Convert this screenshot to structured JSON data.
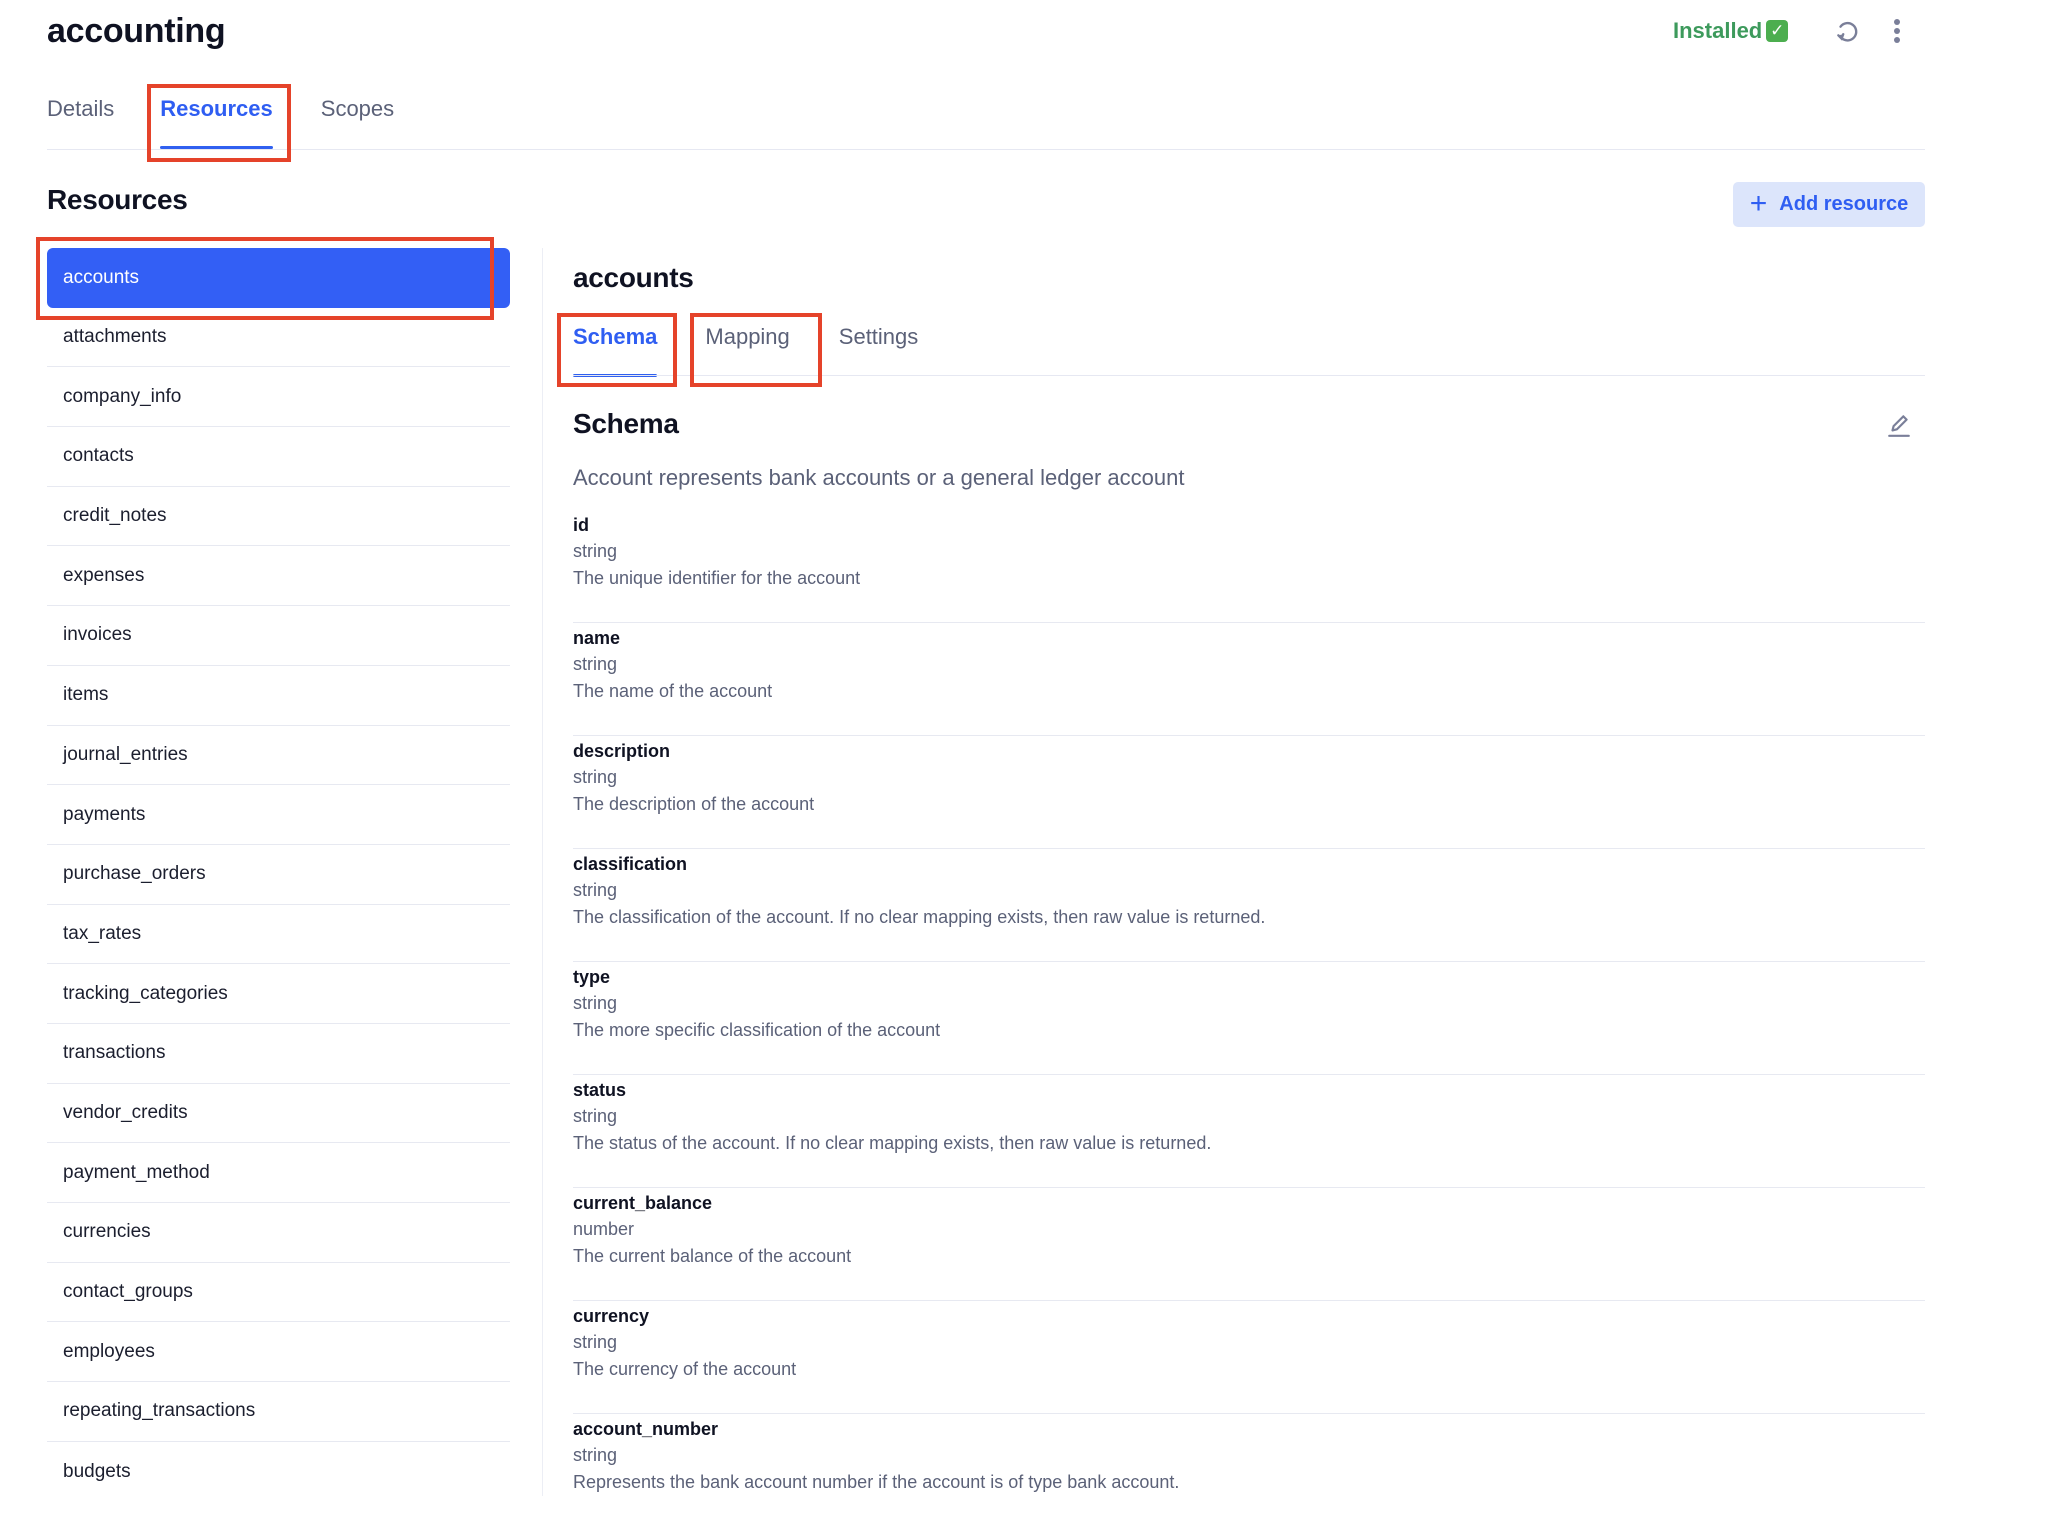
{
  "header": {
    "title": "accounting",
    "status_label": "Installed",
    "status_icon": "check-mark-button-icon",
    "status_color": "#3d9a5c",
    "actions": [
      "refresh-icon",
      "more-vertical-icon"
    ]
  },
  "top_tabs": [
    {
      "label": "Details",
      "active": false
    },
    {
      "label": "Resources",
      "active": true
    },
    {
      "label": "Scopes",
      "active": false
    }
  ],
  "resources": {
    "heading": "Resources",
    "add_button_label": "Add resource",
    "items": [
      {
        "label": "accounts",
        "active": true
      },
      {
        "label": "attachments"
      },
      {
        "label": "company_info"
      },
      {
        "label": "contacts"
      },
      {
        "label": "credit_notes"
      },
      {
        "label": "expenses"
      },
      {
        "label": "invoices"
      },
      {
        "label": "items"
      },
      {
        "label": "journal_entries"
      },
      {
        "label": "payments"
      },
      {
        "label": "purchase_orders"
      },
      {
        "label": "tax_rates"
      },
      {
        "label": "tracking_categories"
      },
      {
        "label": "transactions"
      },
      {
        "label": "vendor_credits"
      },
      {
        "label": "payment_method"
      },
      {
        "label": "currencies"
      },
      {
        "label": "contact_groups"
      },
      {
        "label": "employees"
      },
      {
        "label": "repeating_transactions"
      },
      {
        "label": "budgets"
      }
    ]
  },
  "detail": {
    "title": "accounts",
    "tabs": [
      {
        "label": "Schema",
        "active": true
      },
      {
        "label": "Mapping",
        "active": false
      },
      {
        "label": "Settings",
        "active": false
      }
    ],
    "schema": {
      "heading": "Schema",
      "description": "Account represents bank accounts or a general ledger account",
      "fields": [
        {
          "name": "id",
          "type": "string",
          "description": "The unique identifier for the account"
        },
        {
          "name": "name",
          "type": "string",
          "description": "The name of the account"
        },
        {
          "name": "description",
          "type": "string",
          "description": "The description of the account"
        },
        {
          "name": "classification",
          "type": "string",
          "description": "The classification of the account. If no clear mapping exists, then raw value is returned."
        },
        {
          "name": "type",
          "type": "string",
          "description": "The more specific classification of the account"
        },
        {
          "name": "status",
          "type": "string",
          "description": "The status of the account. If no clear mapping exists, then raw value is returned."
        },
        {
          "name": "current_balance",
          "type": "number",
          "description": "The current balance of the account"
        },
        {
          "name": "currency",
          "type": "string",
          "description": "The currency of the account"
        },
        {
          "name": "account_number",
          "type": "string",
          "description": "Represents the bank account number if the account is of type bank account."
        }
      ]
    }
  },
  "colors": {
    "accent": "#335ff5",
    "highlight_outline": "#e5432a",
    "add_button_bg": "#dce5fb"
  }
}
